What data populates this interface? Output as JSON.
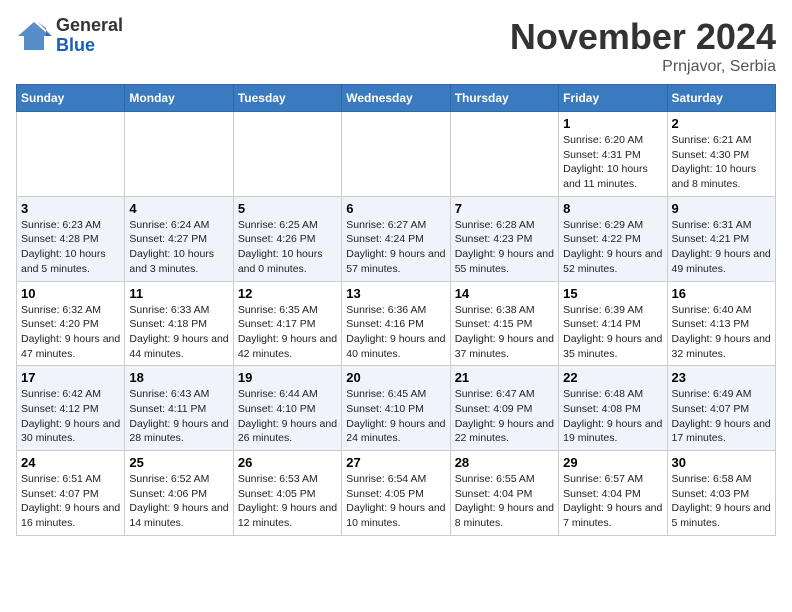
{
  "logo": {
    "general": "General",
    "blue": "Blue"
  },
  "header": {
    "month": "November 2024",
    "location": "Prnjavor, Serbia"
  },
  "days_of_week": [
    "Sunday",
    "Monday",
    "Tuesday",
    "Wednesday",
    "Thursday",
    "Friday",
    "Saturday"
  ],
  "weeks": [
    [
      {
        "day": "",
        "info": ""
      },
      {
        "day": "",
        "info": ""
      },
      {
        "day": "",
        "info": ""
      },
      {
        "day": "",
        "info": ""
      },
      {
        "day": "",
        "info": ""
      },
      {
        "day": "1",
        "info": "Sunrise: 6:20 AM\nSunset: 4:31 PM\nDaylight: 10 hours and 11 minutes."
      },
      {
        "day": "2",
        "info": "Sunrise: 6:21 AM\nSunset: 4:30 PM\nDaylight: 10 hours and 8 minutes."
      }
    ],
    [
      {
        "day": "3",
        "info": "Sunrise: 6:23 AM\nSunset: 4:28 PM\nDaylight: 10 hours and 5 minutes."
      },
      {
        "day": "4",
        "info": "Sunrise: 6:24 AM\nSunset: 4:27 PM\nDaylight: 10 hours and 3 minutes."
      },
      {
        "day": "5",
        "info": "Sunrise: 6:25 AM\nSunset: 4:26 PM\nDaylight: 10 hours and 0 minutes."
      },
      {
        "day": "6",
        "info": "Sunrise: 6:27 AM\nSunset: 4:24 PM\nDaylight: 9 hours and 57 minutes."
      },
      {
        "day": "7",
        "info": "Sunrise: 6:28 AM\nSunset: 4:23 PM\nDaylight: 9 hours and 55 minutes."
      },
      {
        "day": "8",
        "info": "Sunrise: 6:29 AM\nSunset: 4:22 PM\nDaylight: 9 hours and 52 minutes."
      },
      {
        "day": "9",
        "info": "Sunrise: 6:31 AM\nSunset: 4:21 PM\nDaylight: 9 hours and 49 minutes."
      }
    ],
    [
      {
        "day": "10",
        "info": "Sunrise: 6:32 AM\nSunset: 4:20 PM\nDaylight: 9 hours and 47 minutes."
      },
      {
        "day": "11",
        "info": "Sunrise: 6:33 AM\nSunset: 4:18 PM\nDaylight: 9 hours and 44 minutes."
      },
      {
        "day": "12",
        "info": "Sunrise: 6:35 AM\nSunset: 4:17 PM\nDaylight: 9 hours and 42 minutes."
      },
      {
        "day": "13",
        "info": "Sunrise: 6:36 AM\nSunset: 4:16 PM\nDaylight: 9 hours and 40 minutes."
      },
      {
        "day": "14",
        "info": "Sunrise: 6:38 AM\nSunset: 4:15 PM\nDaylight: 9 hours and 37 minutes."
      },
      {
        "day": "15",
        "info": "Sunrise: 6:39 AM\nSunset: 4:14 PM\nDaylight: 9 hours and 35 minutes."
      },
      {
        "day": "16",
        "info": "Sunrise: 6:40 AM\nSunset: 4:13 PM\nDaylight: 9 hours and 32 minutes."
      }
    ],
    [
      {
        "day": "17",
        "info": "Sunrise: 6:42 AM\nSunset: 4:12 PM\nDaylight: 9 hours and 30 minutes."
      },
      {
        "day": "18",
        "info": "Sunrise: 6:43 AM\nSunset: 4:11 PM\nDaylight: 9 hours and 28 minutes."
      },
      {
        "day": "19",
        "info": "Sunrise: 6:44 AM\nSunset: 4:10 PM\nDaylight: 9 hours and 26 minutes."
      },
      {
        "day": "20",
        "info": "Sunrise: 6:45 AM\nSunset: 4:10 PM\nDaylight: 9 hours and 24 minutes."
      },
      {
        "day": "21",
        "info": "Sunrise: 6:47 AM\nSunset: 4:09 PM\nDaylight: 9 hours and 22 minutes."
      },
      {
        "day": "22",
        "info": "Sunrise: 6:48 AM\nSunset: 4:08 PM\nDaylight: 9 hours and 19 minutes."
      },
      {
        "day": "23",
        "info": "Sunrise: 6:49 AM\nSunset: 4:07 PM\nDaylight: 9 hours and 17 minutes."
      }
    ],
    [
      {
        "day": "24",
        "info": "Sunrise: 6:51 AM\nSunset: 4:07 PM\nDaylight: 9 hours and 16 minutes."
      },
      {
        "day": "25",
        "info": "Sunrise: 6:52 AM\nSunset: 4:06 PM\nDaylight: 9 hours and 14 minutes."
      },
      {
        "day": "26",
        "info": "Sunrise: 6:53 AM\nSunset: 4:05 PM\nDaylight: 9 hours and 12 minutes."
      },
      {
        "day": "27",
        "info": "Sunrise: 6:54 AM\nSunset: 4:05 PM\nDaylight: 9 hours and 10 minutes."
      },
      {
        "day": "28",
        "info": "Sunrise: 6:55 AM\nSunset: 4:04 PM\nDaylight: 9 hours and 8 minutes."
      },
      {
        "day": "29",
        "info": "Sunrise: 6:57 AM\nSunset: 4:04 PM\nDaylight: 9 hours and 7 minutes."
      },
      {
        "day": "30",
        "info": "Sunrise: 6:58 AM\nSunset: 4:03 PM\nDaylight: 9 hours and 5 minutes."
      }
    ]
  ]
}
